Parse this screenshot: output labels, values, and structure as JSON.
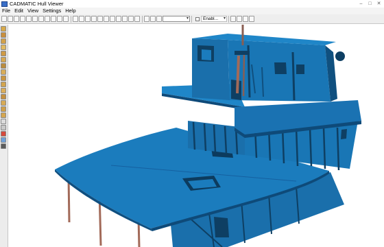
{
  "window": {
    "title": "CADMATIC Hull Viewer",
    "controls": [
      "minimize-icon",
      "maximize-icon",
      "close-icon"
    ]
  },
  "menu": {
    "items": [
      "File",
      "Edit",
      "View",
      "Settings",
      "Help"
    ]
  },
  "toolbar": {
    "buttons_a": [
      "new-file-icon",
      "open-icon",
      "save-icon",
      "print-icon",
      "cut-icon",
      "copy-icon",
      "paste-icon",
      "redo-icon",
      "pointer-icon",
      "pan-icon",
      "rotate-icon"
    ],
    "buttons_b": [
      "zoom-window-icon",
      "zoom-fit-icon",
      "zoom-in-icon",
      "zoom-out-icon",
      "rotate-left-icon",
      "rotate-right-icon",
      "view-front-icon",
      "view-side-icon",
      "view-top-icon",
      "view-iso-icon",
      "walk-icon"
    ],
    "buttons_c": [
      "camera-icon",
      "light-icon",
      "wire-icon"
    ],
    "view_select_value": "",
    "enable_label": "Enabl...",
    "buttons_d": [
      "shade-icon",
      "render-icon",
      "color-icon",
      "outline-icon"
    ]
  },
  "sidebar": {
    "buttons": [
      {
        "icon": "layer-hull-icon",
        "color": "#d7a94a"
      },
      {
        "icon": "layer-deck-icon",
        "color": "#c98f3d"
      },
      {
        "icon": "layer-bulkhead-icon",
        "color": "#d2a14a"
      },
      {
        "icon": "layer-plate-icon",
        "color": "#e0b860"
      },
      {
        "icon": "layer-profile-icon",
        "color": "#cf9a44"
      },
      {
        "icon": "layer-bracket-icon",
        "color": "#d6a852"
      },
      {
        "icon": "layer-girder-icon",
        "color": "#ba8c3e"
      },
      {
        "icon": "layer-frame-icon",
        "color": "#d9ad58"
      },
      {
        "icon": "layer-stiffener-icon",
        "color": "#c99540"
      },
      {
        "icon": "layer-pillar-icon",
        "color": "#d3a54e"
      },
      {
        "icon": "layer-opening-icon",
        "color": "#dcae5a"
      },
      {
        "icon": "layer-seam-icon",
        "color": "#c49040"
      },
      {
        "icon": "layer-weld-icon",
        "color": "#d8ab55"
      },
      {
        "icon": "layer-block-icon",
        "color": "#cfa04a"
      },
      {
        "icon": "layer-misc-icon",
        "color": "#d5a650"
      },
      {
        "icon": "search-icon",
        "color": "#dcdcdc"
      },
      {
        "icon": "clip-icon",
        "color": "#c8c8c8"
      },
      {
        "icon": "highlight-icon",
        "color": "#d64a3c"
      },
      {
        "icon": "measure-icon",
        "color": "#6fa0d8"
      },
      {
        "icon": "section-icon",
        "color": "#5c5c5c"
      }
    ]
  },
  "colors": {
    "model_blue": "#1b78b7",
    "model_dark": "#0e3f63",
    "pillar": "#a26a59",
    "toolbar_bg": "#eeeeee"
  }
}
